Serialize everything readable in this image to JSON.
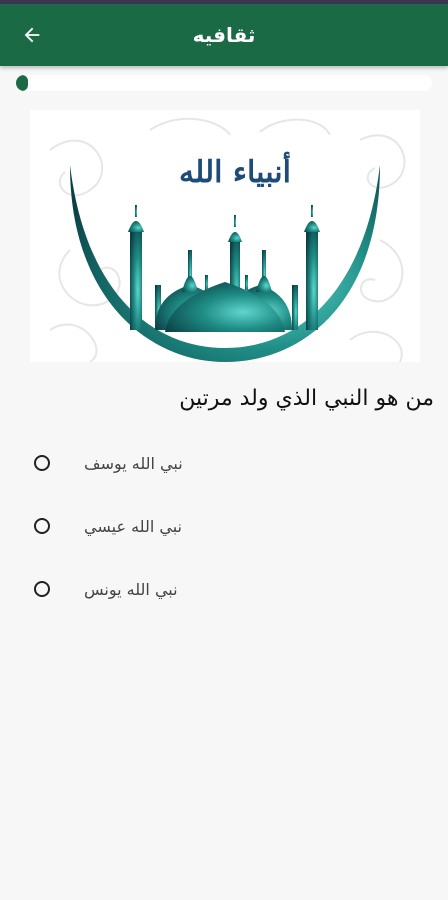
{
  "app_bar": {
    "title": "ثقافيه",
    "back_icon": "arrow-left-icon",
    "color": "#1b6a46"
  },
  "progress": {
    "fraction": 0.03
  },
  "banner": {
    "caption": "أنبياء الله",
    "accent": "#1f8d85"
  },
  "question": {
    "text": "من هو النبي الذي ولد مرتين",
    "options": [
      {
        "label": "نبي الله يوسف",
        "selected": false
      },
      {
        "label": "نبي الله عيسي",
        "selected": false
      },
      {
        "label": "نبي الله يونس",
        "selected": false
      }
    ]
  }
}
